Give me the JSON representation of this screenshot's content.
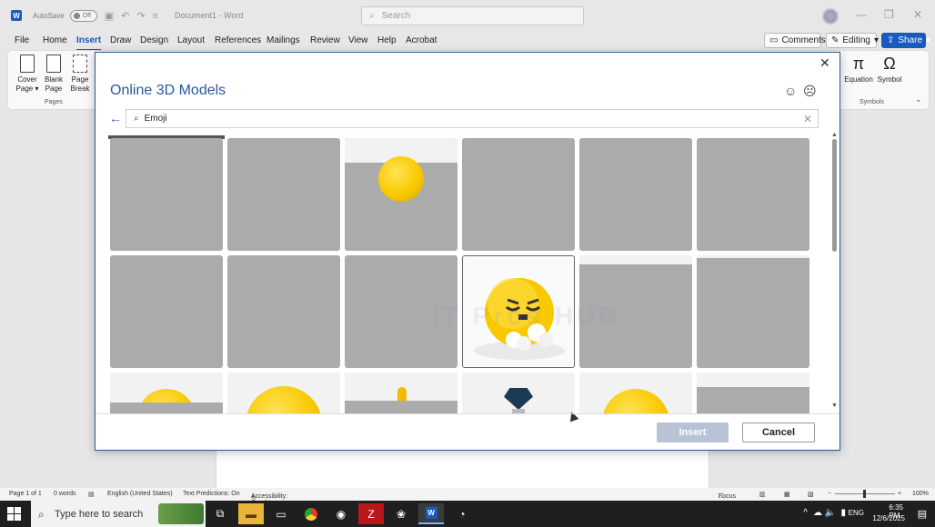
{
  "titlebar": {
    "autosave_label": "AutoSave",
    "autosave_state": "Off",
    "document_name": "Document1",
    "app_name": "Word",
    "search_placeholder": "Search"
  },
  "menu": {
    "tabs": [
      "File",
      "Home",
      "Insert",
      "Draw",
      "Design",
      "Layout",
      "References",
      "Mailings",
      "Review",
      "View",
      "Help",
      "Acrobat"
    ],
    "active_tab": "Insert",
    "comments_label": "Comments",
    "editing_label": "Editing",
    "share_label": "Share"
  },
  "ribbon": {
    "pages_buttons": [
      {
        "line1": "Cover",
        "line2": "Page ▾"
      },
      {
        "line1": "Blank",
        "line2": "Page"
      },
      {
        "line1": "Page",
        "line2": "Break"
      }
    ],
    "pages_group_label": "Pages",
    "equation_label": "Equation",
    "symbol_label": "Symbol",
    "symbols_group_label": "Symbols"
  },
  "dialog": {
    "title": "Online 3D Models",
    "search_value": "Emoji",
    "insert_label": "Insert",
    "cancel_label": "Cancel",
    "watermark": "IT Pros HUB"
  },
  "statusbar": {
    "page": "Page 1 of 1",
    "words": "0 words",
    "language": "English (United States)",
    "predictions": "Text Predictions: On",
    "accessibility": "Accessibility: Good to go",
    "focus": "Focus",
    "zoom": "100%"
  },
  "taskbar": {
    "search_placeholder": "Type here to search",
    "language": "ENG",
    "time": "6:35 PM",
    "date": "12/6/2025"
  },
  "colors": {
    "accent": "#185abd",
    "dialog_title": "#2b579a",
    "tile_placeholder": "#ababab",
    "emoji_yellow": "#f8c900"
  }
}
